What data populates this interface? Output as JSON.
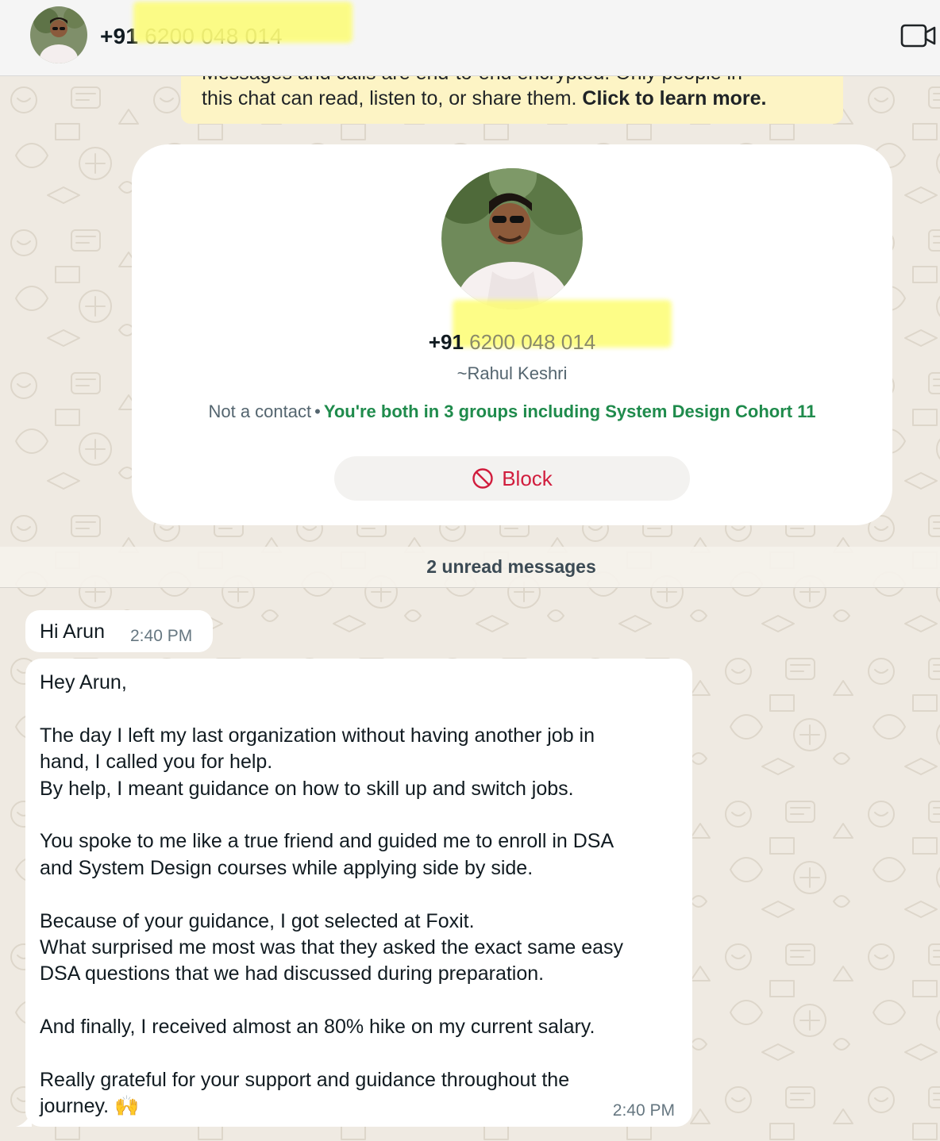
{
  "header": {
    "title_prefix": "+91",
    "title_number": " 6200 048 014",
    "video_call_icon": "video-camera-icon"
  },
  "encryption_notice": {
    "line1": "Messages and calls are end-to-end encrypted. Only people in",
    "line2": "this chat can read, listen to, or share them.",
    "link": "Click to learn more."
  },
  "contact_card": {
    "phone_prefix": "+91",
    "phone_number": " 6200 048 014",
    "push_name": "~Rahul Keshri",
    "not_contact": "Not a contact",
    "separator": "•",
    "groups_text": "You're both in 3 groups including System Design Cohort 11",
    "block_label": "Block",
    "block_icon": "block-icon"
  },
  "unread_divider": "2 unread messages",
  "messages": [
    {
      "text": "Hi Arun",
      "time": "2:40 PM"
    },
    {
      "paragraphs": [
        [
          "Hey Arun,"
        ],
        [
          "The day I left my last organization without having another job in",
          "hand, I called you for help.",
          "By help, I meant guidance on how to skill up and switch jobs."
        ],
        [
          "You spoke to me like a true friend and guided me to enroll in DSA",
          "and System Design courses while applying side by side."
        ],
        [
          "Because of your guidance, I got selected at Foxit.",
          "What surprised me most was that they asked the exact same easy",
          "DSA questions that we had discussed during preparation."
        ],
        [
          "And finally, I received almost an 80% hike on my current salary."
        ],
        [
          "Really grateful for your support and guidance throughout the",
          "journey. 🙌"
        ]
      ],
      "time": "2:40 PM"
    }
  ],
  "colors": {
    "background": "#efeae2",
    "header": "#f5f5f5",
    "notice": "#fdf4c5",
    "accent_green": "#1f8b4c",
    "block_red": "#d11d3d",
    "highlight": "#fdfd73"
  }
}
